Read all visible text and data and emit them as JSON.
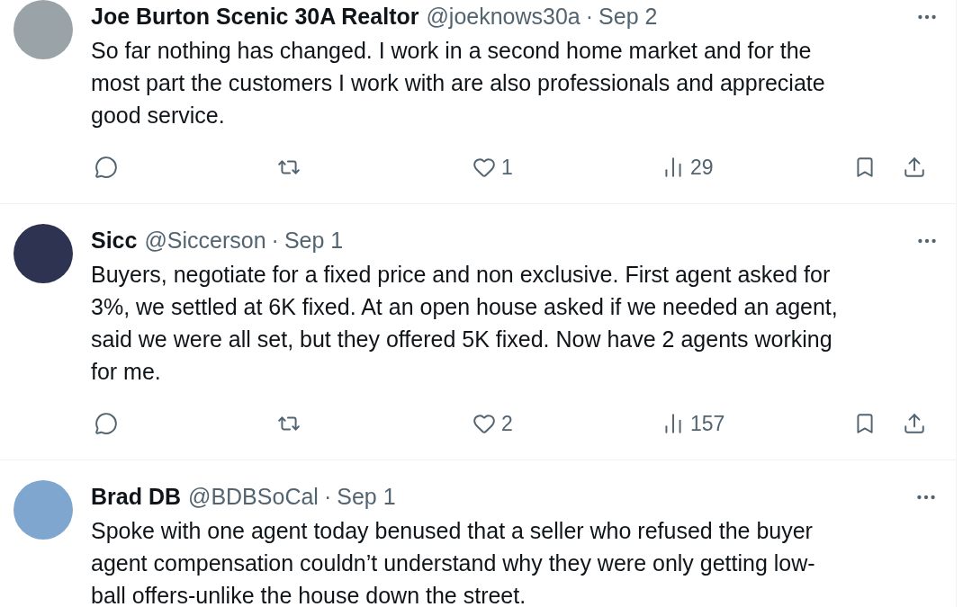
{
  "tweets": [
    {
      "name": "Joe Burton Scenic 30A Realtor",
      "handle": "@joeknows30a",
      "separator": "·",
      "date": "Sep 2",
      "lines": [
        "So far nothing has changed. I work in a second home market and for the",
        "most part the customers I work with are also professionals and appreciate",
        "good service."
      ],
      "actions": [
        {
          "kind": "reply"
        },
        {
          "kind": "retweet"
        },
        {
          "kind": "like",
          "count": "1"
        },
        {
          "kind": "views",
          "count": "29"
        },
        {
          "kind": "bookmark"
        },
        {
          "kind": "share"
        }
      ]
    },
    {
      "name": "Sicc",
      "handle": "@Siccerson",
      "separator": "·",
      "date": "Sep 1",
      "lines": [
        "Buyers, negotiate for a fixed price and non exclusive. First agent asked for",
        "3%, we settled at 6K fixed. At an open house asked if we needed an agent,",
        "said we were all set, but they offered 5K fixed. Now have 2 agents working",
        "for me."
      ],
      "actions": [
        {
          "kind": "reply"
        },
        {
          "kind": "retweet"
        },
        {
          "kind": "like",
          "count": "2"
        },
        {
          "kind": "views",
          "count": "157"
        },
        {
          "kind": "bookmark"
        },
        {
          "kind": "share"
        }
      ]
    },
    {
      "name": "Brad DB",
      "handle": "@BDBSoCal",
      "separator": "·",
      "date": "Sep 1",
      "lines": [
        "Spoke with one agent today benused that a seller who refused the buyer",
        "agent compensation couldn’t understand why they were only getting low-",
        "ball offers-unlike the house down the street."
      ]
    }
  ]
}
